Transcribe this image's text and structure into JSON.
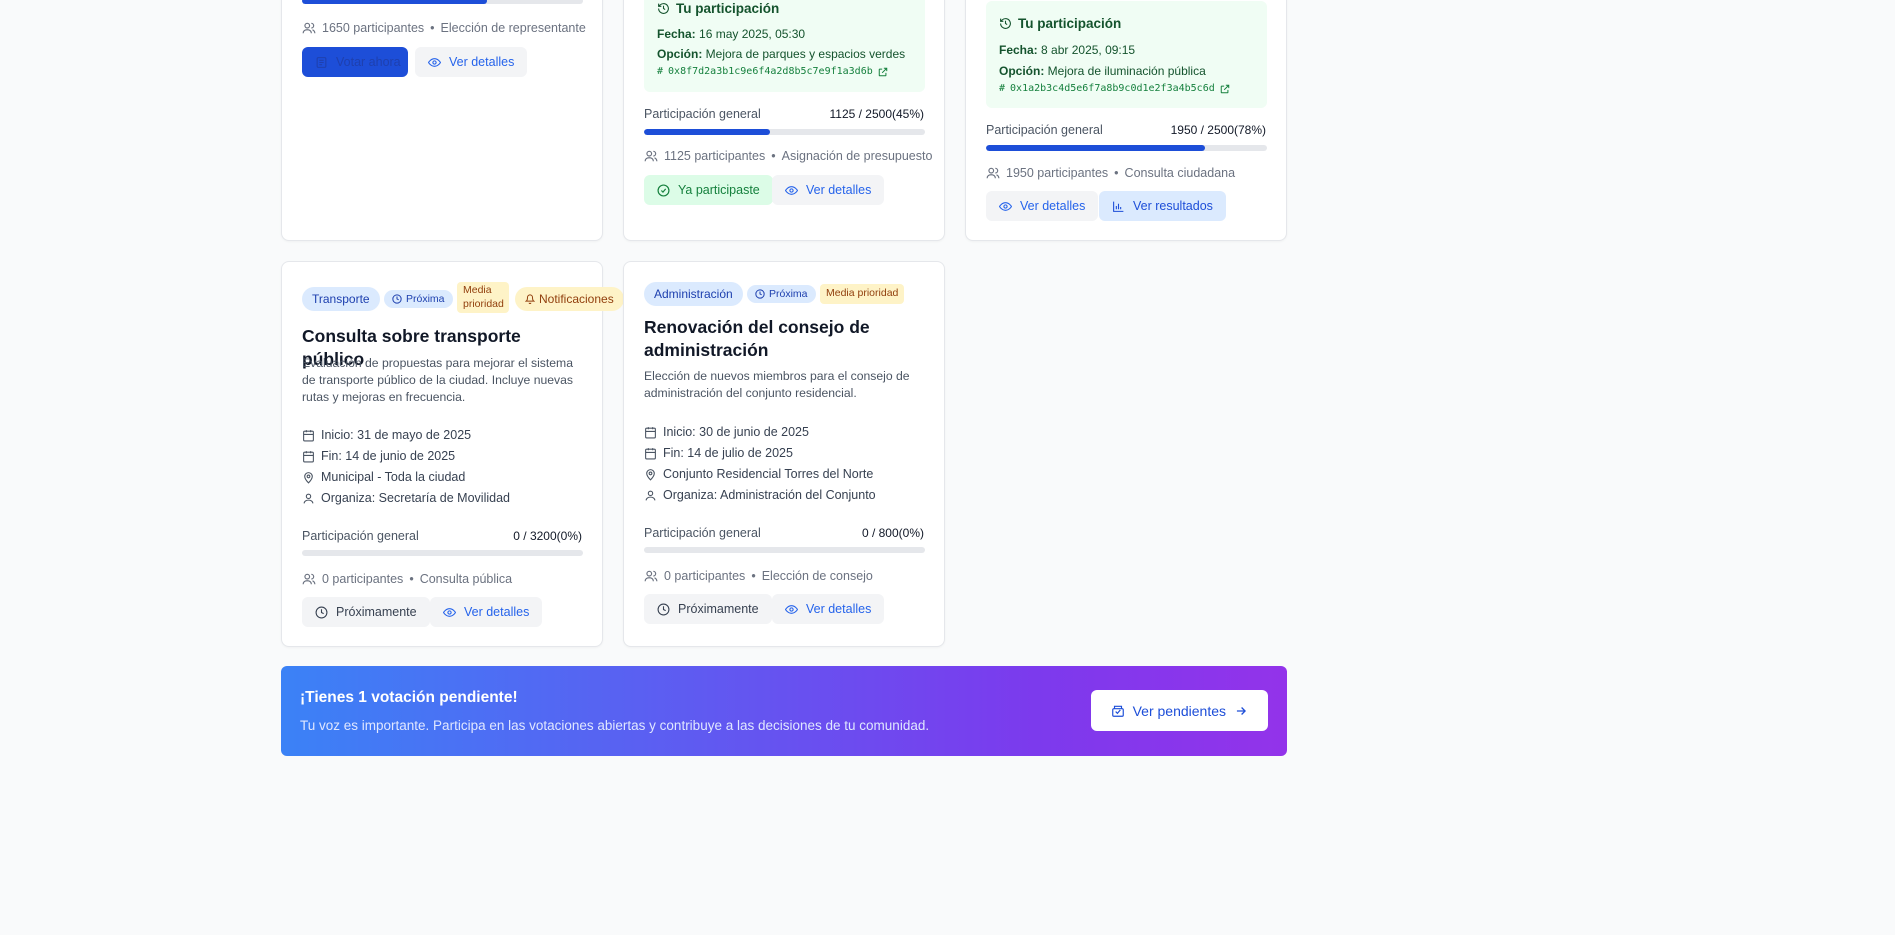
{
  "card1": {
    "participants": "1650 participantes",
    "type": "Elección de representante",
    "progress": 0.66,
    "vote_label": "Votar ahora",
    "details_label": "Ver detalles"
  },
  "card2": {
    "participation_title": "Tu participación",
    "date_label": "Fecha:",
    "date_value": "16 may 2025, 05:30",
    "option_label": "Opción:",
    "option_value": "Mejora de parques y espacios verdes",
    "tx_hash": "0x8f7d2a3b1c9e6f4a2d8b5c7e9f1a3d6b",
    "general_label": "Participación general",
    "general_value": "1125 / 2500(45%)",
    "progress": 0.45,
    "participants": "1125 participantes",
    "type": "Asignación de presupuesto",
    "participated_label": "Ya participaste",
    "details_label": "Ver detalles"
  },
  "card3": {
    "participation_title": "Tu participación",
    "date_label": "Fecha:",
    "date_value": "8 abr 2025, 09:15",
    "option_label": "Opción:",
    "option_value": "Mejora de iluminación pública",
    "tx_hash": "0x1a2b3c4d5e6f7a8b9c0d1e2f3a4b5c6d",
    "general_label": "Participación general",
    "general_value": "1950 / 2500(78%)",
    "progress": 0.78,
    "participants": "1950 participantes",
    "type": "Consulta ciudadana",
    "details_label": "Ver detalles",
    "results_label": "Ver resultados"
  },
  "card4": {
    "category": "Transporte",
    "status": "Próxima",
    "priority": "Media prioridad",
    "notifications": "Notificaciones",
    "title": "Consulta sobre transporte público",
    "description": "Evaluación de propuestas para mejorar el sistema de transporte público de la ciudad. Incluye nuevas rutas y mejoras en frecuencia.",
    "start": "Inicio: 31 de mayo de 2025",
    "end": "Fin: 14 de junio de 2025",
    "location": "Municipal - Toda la ciudad",
    "organizer": "Organiza: Secretaría de Movilidad",
    "general_label": "Participación general",
    "general_value": "0 / 3200(0%)",
    "progress": 0,
    "participants": "0 participantes",
    "type": "Consulta pública",
    "soon_label": "Próximamente",
    "details_label": "Ver detalles"
  },
  "card5": {
    "category": "Administración",
    "status": "Próxima",
    "priority": "Media prioridad",
    "title": "Renovación del consejo de administración",
    "description": "Elección de nuevos miembros para el consejo de administración del conjunto residencial.",
    "start": "Inicio: 30 de junio de 2025",
    "end": "Fin: 14 de julio de 2025",
    "location": "Conjunto Residencial Torres del Norte",
    "organizer": "Organiza: Administración del Conjunto",
    "general_label": "Participación general",
    "general_value": "0 / 800(0%)",
    "progress": 0,
    "participants": "0 participantes",
    "type": "Elección de consejo",
    "soon_label": "Próximamente",
    "details_label": "Ver detalles"
  },
  "banner": {
    "title": "¡Tienes 1 votación pendiente!",
    "subtitle": "Tu voz es importante. Participa en las votaciones abiertas y contribuye a las decisiones de tu comunidad.",
    "button_label": "Ver pendientes"
  },
  "colors": {
    "accent": "#1d4ed8",
    "success_bg": "#f0fdf4",
    "banner_start": "#3b82f6",
    "banner_end": "#9333ea"
  }
}
